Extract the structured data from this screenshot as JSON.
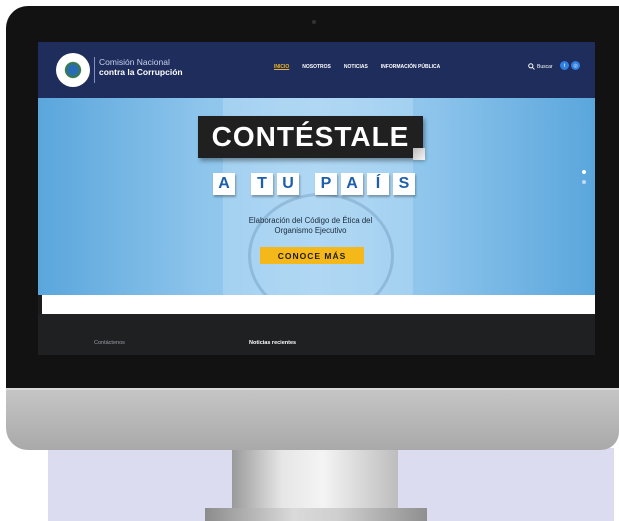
{
  "site": {
    "logo_line1": "Comisión Nacional",
    "logo_line2": "contra la Corrupción"
  },
  "nav": {
    "items": [
      {
        "label": "INICIO",
        "active": true
      },
      {
        "label": "NOSOTROS",
        "active": false
      },
      {
        "label": "NOTICIAS",
        "active": false
      },
      {
        "label": "INFORMACIÓN PÚBLICA",
        "active": false
      }
    ],
    "search_label": "Buscar",
    "social_icons": [
      "twitter-icon",
      "instagram-icon"
    ]
  },
  "hero": {
    "title": "CONTÉSTALE",
    "tiles": [
      "A",
      "T",
      "U",
      "P",
      "A",
      "Í",
      "S"
    ],
    "subtitle_line1": "Elaboración del Código de Ética del",
    "subtitle_line2": "Organismo Ejecutivo",
    "cta_label": "CONOCE MÁS",
    "slides_total": 2,
    "slide_active": 1
  },
  "footer": {
    "contact_heading": "Contáctenos",
    "news_heading": "Noticias recientes"
  },
  "colors": {
    "nav_bg": "#1e2d5c",
    "accent": "#f5b81b",
    "tile_text": "#1d5faa",
    "hero_bg": "#8ec5ec",
    "footer_bg": "#1f2022"
  }
}
